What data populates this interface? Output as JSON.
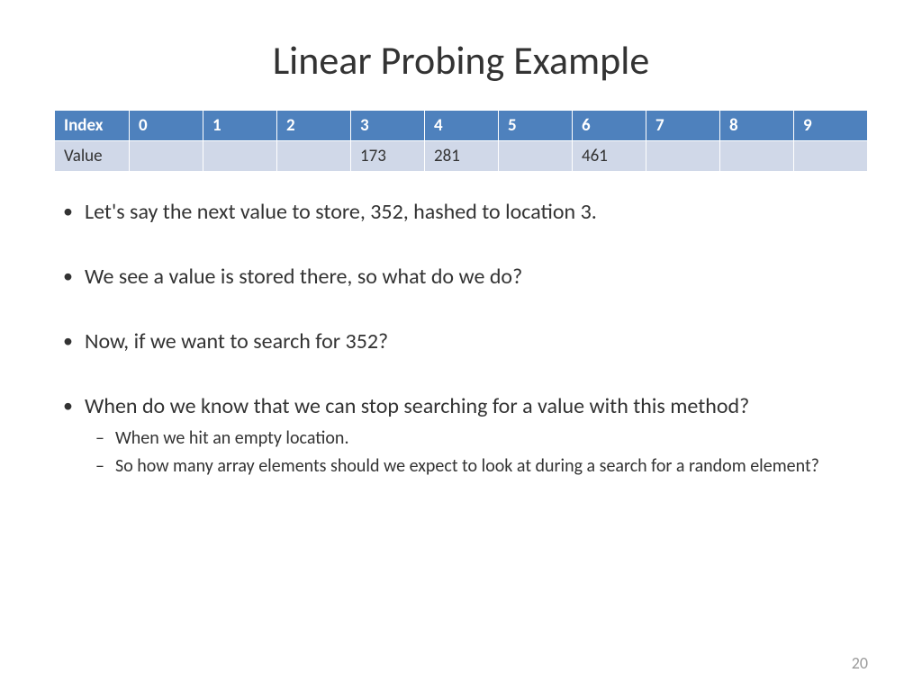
{
  "title": "Linear Probing Example",
  "table": {
    "index_label": "Index",
    "value_label": "Value",
    "indices": [
      "0",
      "1",
      "2",
      "3",
      "4",
      "5",
      "6",
      "7",
      "8",
      "9"
    ],
    "values": [
      "",
      "",
      "",
      "173",
      "281",
      "",
      "461",
      "",
      "",
      ""
    ]
  },
  "bullets": [
    "Let's say the next value to store, 352, hashed to location 3.",
    "We see a value is stored there, so what do we do?",
    "Now, if we want to search for 352?"
  ],
  "last_bullet": "When do we know that we can stop searching for a value with this method?",
  "sub_bullets": [
    "When we hit an empty location.",
    "So how many array elements should we expect to look at during a search for a random element?"
  ],
  "page_number": "20"
}
